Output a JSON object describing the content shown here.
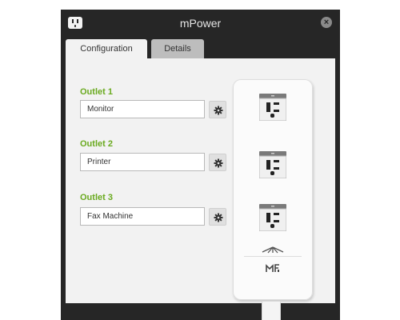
{
  "window": {
    "title": "mPower"
  },
  "tabs": [
    {
      "label": "Configuration",
      "active": true
    },
    {
      "label": "Details",
      "active": false
    }
  ],
  "outlets": [
    {
      "label": "Outlet 1",
      "name": "Monitor"
    },
    {
      "label": "Outlet 2",
      "name": "Printer"
    },
    {
      "label": "Outlet 3",
      "name": "Fax Machine"
    }
  ],
  "colors": {
    "outlet_label": "#6aaa1f",
    "window_bg": "#262626",
    "panel_bg": "#f2f2f2"
  },
  "icons": {
    "app": "power-outlet-icon",
    "close": "close-icon",
    "settings": "gear-icon",
    "brand": "ubiquiti-logo-icon",
    "product": "mfi-logo-icon"
  }
}
